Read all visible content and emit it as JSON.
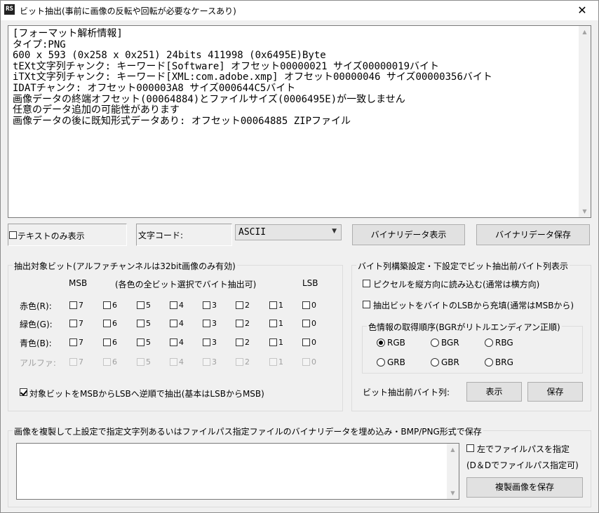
{
  "window": {
    "title": "ビット抽出(事前に画像の反転や回転が必要なケースあり)",
    "icon_text": "RS",
    "close_symbol": "✕"
  },
  "analysis": {
    "lines": [
      "[フォーマット解析情報]",
      "タイプ:PNG",
      "600 x 593 (0x258 x 0x251)  24bits  411998 (0x6495E)Byte",
      "tEXt文字列チャンク: キーワード[Software] オフセット00000021 サイズ00000019バイト",
      "iTXt文字列チャンク: キーワード[XML:com.adobe.xmp] オフセット00000046 サイズ00000356バイト",
      "IDATチャンク: オフセット000003A8 サイズ000644C5バイト",
      "画像データの終端オフセット(00064884)とファイルサイズ(0006495E)が一致しません",
      "任意のデータ追加の可能性があります",
      "画像データの後に既知形式データあり: オフセット00064885 ZIPファイル"
    ]
  },
  "toolbar": {
    "text_only_label": "テキストのみ表示",
    "encoding_label": "文字コード:",
    "encoding_value": "ASCII",
    "show_binary_label": "バイナリデータ表示",
    "save_binary_label": "バイナリデータ保存"
  },
  "bits": {
    "group_title": "抽出対象ビット(アルファチャンネルは32bit画像のみ有効)",
    "msb_label": "MSB",
    "note": "(各色の全ビット選択でバイト抽出可)",
    "lsb_label": "LSB",
    "bit_labels": [
      "7",
      "6",
      "5",
      "4",
      "3",
      "2",
      "1",
      "0"
    ],
    "rows": [
      {
        "label": "赤色(R):"
      },
      {
        "label": "緑色(G):"
      },
      {
        "label": "青色(B):"
      },
      {
        "label": "アルファ:"
      }
    ],
    "reverse_label": "対象ビットをMSBからLSBへ逆順で抽出(基本はLSBからMSB)"
  },
  "byte_build": {
    "group_title": "バイト列構築設定・下設定でビット抽出前バイト列表示",
    "vertical_label": "ピクセルを縦方向に読み込む(通常は横方向)",
    "fill_lsb_label": "抽出ビットをバイトのLSBから充填(通常はMSBから)",
    "order_title": "色情報の取得順序(BGRがリトルエンディアン正順)",
    "orders": [
      "RGB",
      "BGR",
      "RBG",
      "GRB",
      "GBR",
      "BRG"
    ],
    "selected_order": "RGB",
    "pre_extract_label": "ビット抽出前バイト列:",
    "show_label": "表示",
    "save_label": "保存"
  },
  "embed": {
    "group_title": "画像を複製して上設定で指定文字列あるいはファイルパス指定ファイルのバイナリデータを埋め込み・BMP/PNG形式で保存",
    "file_path_label": "左でファイルパスを指定",
    "dnd_hint": "(D＆Dでファイルパス指定可)",
    "save_copy_label": "複製画像を保存"
  }
}
